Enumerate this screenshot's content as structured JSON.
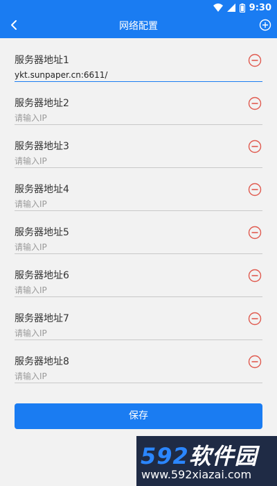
{
  "status_bar": {
    "time": "9:30",
    "icons": [
      "wifi-icon",
      "signal-icon",
      "battery-icon"
    ]
  },
  "app_bar": {
    "title": "网络配置",
    "back_icon": "chevron-left-icon",
    "add_icon": "add-circle-icon"
  },
  "servers": [
    {
      "label": "服务器地址1",
      "value": "ykt.sunpaper.cn:6611/",
      "placeholder": "请输入IP"
    },
    {
      "label": "服务器地址2",
      "value": "",
      "placeholder": "请输入IP"
    },
    {
      "label": "服务器地址3",
      "value": "",
      "placeholder": "请输入IP"
    },
    {
      "label": "服务器地址4",
      "value": "",
      "placeholder": "请输入IP"
    },
    {
      "label": "服务器地址5",
      "value": "",
      "placeholder": "请输入IP"
    },
    {
      "label": "服务器地址6",
      "value": "",
      "placeholder": "请输入IP"
    },
    {
      "label": "服务器地址7",
      "value": "",
      "placeholder": "请输入IP"
    },
    {
      "label": "服务器地址8",
      "value": "",
      "placeholder": "请输入IP"
    }
  ],
  "remove_icon": "remove-circle-icon",
  "save_label": "保存",
  "watermark": {
    "logo_num": "592",
    "logo_text": "软件园",
    "url": "www.592xiazai.com"
  },
  "colors": {
    "primary": "#1a7cf2",
    "background": "#f2f2f2",
    "remove": "#e05a4f"
  }
}
